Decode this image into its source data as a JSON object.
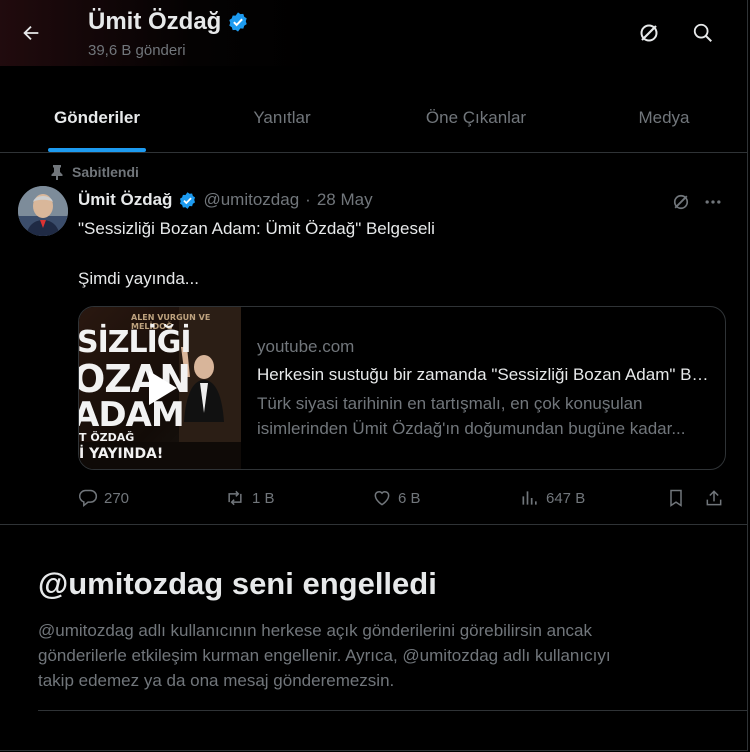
{
  "header": {
    "name": "Ümit Özdağ",
    "post_count": "39,6 B gönderi",
    "icons": [
      "back-arrow-icon",
      "verified-badge-icon",
      "grok-icon",
      "search-icon"
    ]
  },
  "tabs": [
    {
      "label": "Gönderiler",
      "active": true
    },
    {
      "label": "Yanıtlar",
      "active": false
    },
    {
      "label": "Öne Çıkanlar",
      "active": false
    },
    {
      "label": "Medya",
      "active": false
    }
  ],
  "tweet": {
    "pinned_label": "Sabitlendi",
    "author_name": "Ümit Özdağ",
    "handle": "@umitozdag",
    "separator": "·",
    "date": "28 May",
    "text_line1": "\"Sessizliği Bozan Adam: Ümit Özdağ\" Belgeseli",
    "text_line2": "Şimdi yayında...",
    "card": {
      "domain": "youtube.com",
      "title": "Herkesin sustuğu bir zamanda \"Sessizliği Bozan Adam\" Belgeseli",
      "desc_line1": "Türk siyasi tarihinin en tartışmalı, en çok konuşulan",
      "desc_line2": "isimlerinden Ümit Özdağ'ın doğumundan bugüne kadar...",
      "thumb_lines": [
        "SİZLİĞİ",
        "OZAN",
        "ADAM",
        "T ÖZDAĞ",
        "İ YAYINDA!"
      ],
      "thumb_banner": "ALEN VURGUN VE MELİDOĞ"
    },
    "stats": {
      "replies": "270",
      "reposts": "1 B",
      "likes": "6 B",
      "views": "647 B"
    }
  },
  "blocked": {
    "title": "@umitozdag seni engelledi",
    "line1": "@umitozdag adlı kullanıcının herkese açık gönderilerini görebilirsin ancak",
    "line2": "gönderilerle etkileşim kurman engellenir. Ayrıca, @umitozdag adlı kullanıcıyı",
    "line3": "takip edemez ya da ona mesaj gönderemezsin."
  },
  "colors": {
    "background": "#000000",
    "text_primary": "#e7e9ea",
    "text_secondary": "#71767b",
    "accent": "#1d9bf0",
    "border": "#2f3336"
  }
}
